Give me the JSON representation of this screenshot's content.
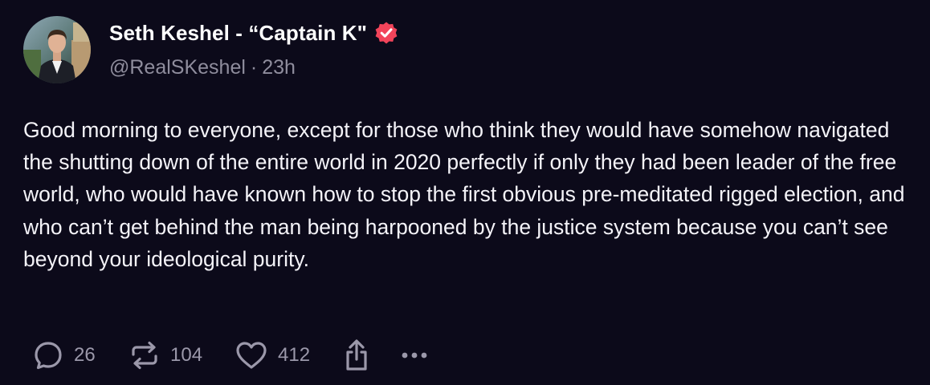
{
  "author": {
    "display_name": "Seth Keshel - “Captain K\"",
    "handle": "@RealSKeshel",
    "separator": "·",
    "time_ago": "23h",
    "verified": true,
    "verified_badge_color": "#f2445a"
  },
  "post": {
    "text": "Good morning to everyone, except for those who think they would have somehow navigated the shutting down of the entire world in 2020 perfectly if only they had been leader of the free world, who would have known how to stop the first obvious pre-meditated rigged election, and who can’t get behind the man being harpooned by the justice system because you can’t see beyond your ideological purity."
  },
  "actions": {
    "reply_count": "26",
    "repost_count": "104",
    "like_count": "412",
    "icons": [
      "reply-icon",
      "repost-icon",
      "heart-icon",
      "share-icon",
      "more-icon"
    ]
  },
  "colors": {
    "background": "#0c0a1a",
    "primary_text": "#ffffff",
    "secondary_text": "#8f8d9d",
    "action_icons": "#9b98aa"
  }
}
